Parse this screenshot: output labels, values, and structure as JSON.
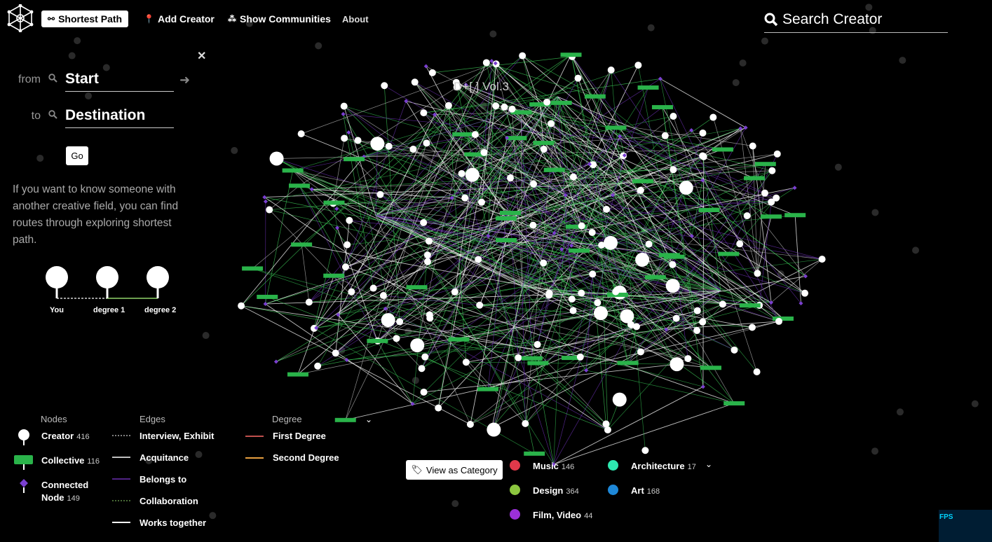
{
  "nav": {
    "shortest_path": "Shortest Path",
    "add_creator": "Add Creator",
    "show_communities": "Show Communities",
    "about": "About"
  },
  "search": {
    "placeholder": "Search Creator"
  },
  "panel": {
    "from_label": "from",
    "to_label": "to",
    "start_placeholder": "Start",
    "destination_placeholder": "Destination",
    "go": "Go",
    "hint": "If you want to know someone with another creative field, you can find routes through exploring shortest path.",
    "degrees": [
      "You",
      "degree 1",
      "degree 2"
    ]
  },
  "highlight_node": "D+[ ] Vol.3",
  "legend": {
    "nodes_header": "Nodes",
    "edges_header": "Edges",
    "degree_header": "Degree",
    "nodes": [
      {
        "label": "Creator",
        "count": "416"
      },
      {
        "label": "Collective",
        "count": "116"
      },
      {
        "label": "Connected Node",
        "count": "149"
      }
    ],
    "edges": [
      "Interview, Exhibit",
      "Acquitance",
      "Belongs to",
      "Collaboration",
      "Works together"
    ],
    "degrees": [
      "First Degree",
      "Second Degree"
    ]
  },
  "view_category": "View as Category",
  "categories": [
    {
      "label": "Music",
      "count": "146",
      "color": "#e0394a"
    },
    {
      "label": "Design",
      "count": "364",
      "color": "#8cc63f"
    },
    {
      "label": "Film, Video",
      "count": "44",
      "color": "#9b30d9"
    },
    {
      "label": "Architecture",
      "count": "17",
      "color": "#2ee8b0"
    },
    {
      "label": "Art",
      "count": "168",
      "color": "#1e88d8"
    }
  ],
  "fps_label": "FPS",
  "colors": {
    "creator": "#ffffff",
    "collective": "#2ab34a",
    "connected": "#6a2fb0",
    "first_degree": "#c0504d",
    "second_degree": "#e8a040"
  }
}
